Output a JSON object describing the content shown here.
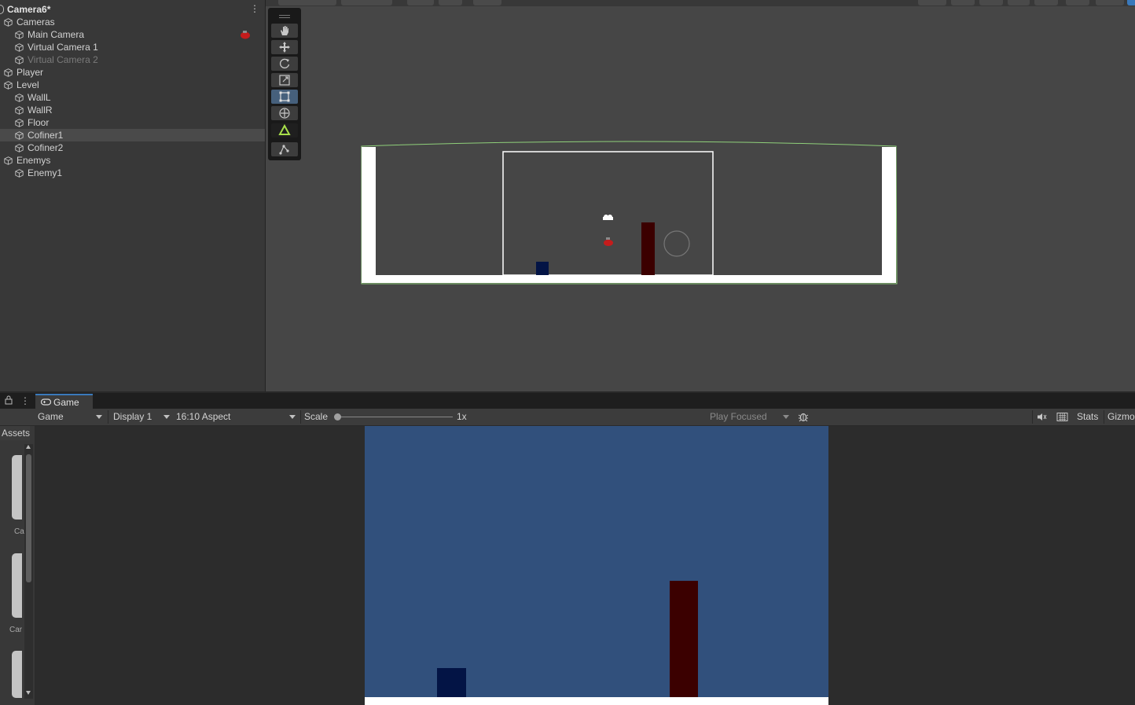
{
  "hierarchy": {
    "scene_name": "Camera6*",
    "items": [
      {
        "label": "Cameras",
        "depth": 0
      },
      {
        "label": "Main Camera",
        "depth": 1
      },
      {
        "label": "Virtual Camera 1",
        "depth": 1
      },
      {
        "label": "Virtual Camera 2",
        "depth": 1,
        "disabled": true
      },
      {
        "label": "Player",
        "depth": 0
      },
      {
        "label": "Level",
        "depth": 0
      },
      {
        "label": "WallL",
        "depth": 1
      },
      {
        "label": "WallR",
        "depth": 1
      },
      {
        "label": "Floor",
        "depth": 1
      },
      {
        "label": "Cofiner1",
        "depth": 1,
        "selected": true
      },
      {
        "label": "Cofiner2",
        "depth": 1
      },
      {
        "label": "Enemys",
        "depth": 0
      },
      {
        "label": "Enemy1",
        "depth": 1
      }
    ]
  },
  "scene": {
    "tools": [
      "hand-tool-icon",
      "move-tool-icon",
      "rotate-tool-icon",
      "scale-tool-icon",
      "rect-tool-icon",
      "transform-tool-icon",
      "custom-tool-icon",
      "bone-tool-icon"
    ],
    "active_tool": "rect-tool-icon"
  },
  "game": {
    "tab_label": "Game",
    "mode": "Game",
    "display": "Display 1",
    "aspect": "16:10 Aspect",
    "scale_label": "Scale",
    "scale_value": "1x",
    "play_mode": "Play Focused",
    "stats_label": "Stats",
    "gizmos_label": "Gizmo"
  },
  "project": {
    "assets_tab": "Assets",
    "thumb_labels": [
      "Ca",
      "Car"
    ]
  },
  "colors": {
    "game_background": "#31507c",
    "enemy": "#3b0000",
    "player": "#031445",
    "selection": "#46607c"
  }
}
